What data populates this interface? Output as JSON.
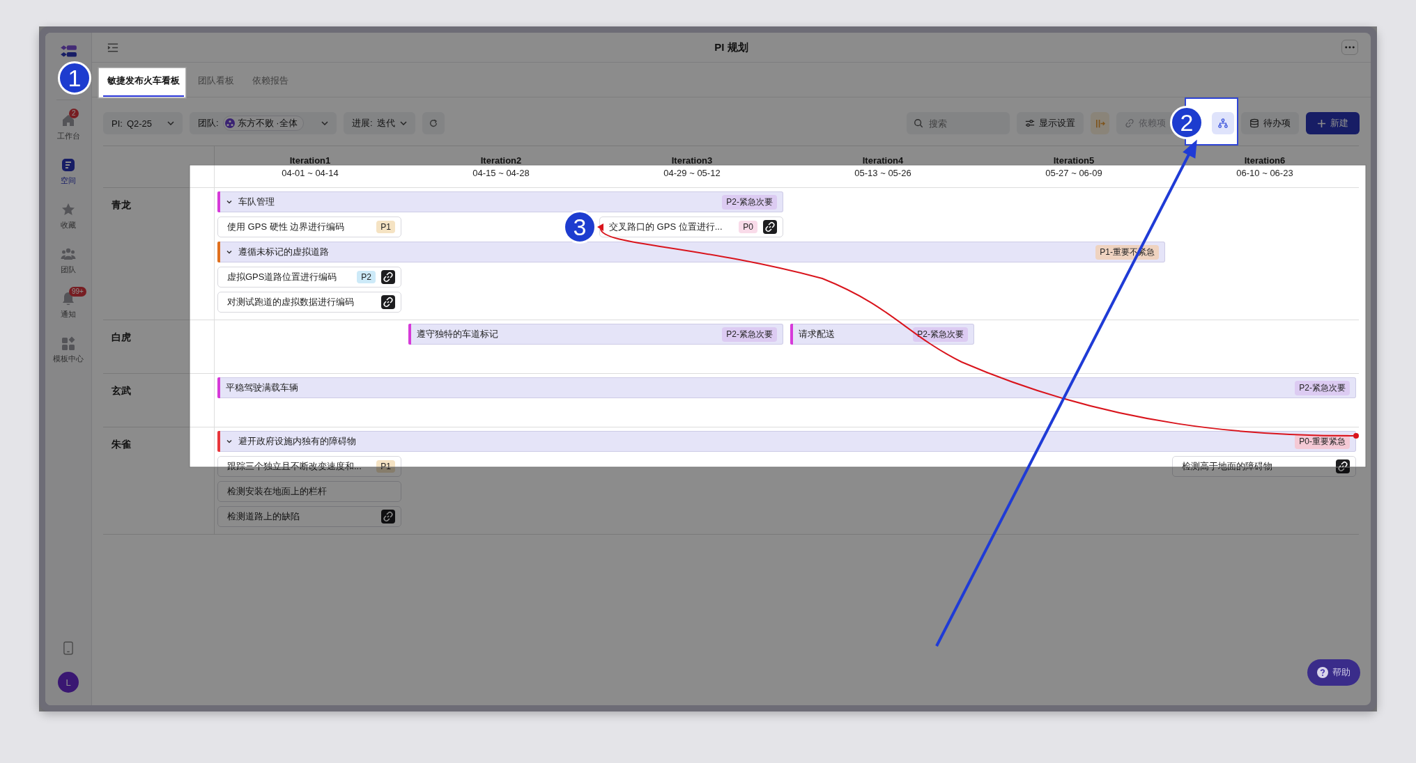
{
  "window": {
    "title": "PI 规划"
  },
  "sidebar": {
    "items": [
      {
        "kind": "home",
        "label": "工作台",
        "badge": "2",
        "selected": false
      },
      {
        "kind": "space",
        "label": "空间",
        "selected": true
      },
      {
        "kind": "star",
        "label": "收藏",
        "selected": false
      },
      {
        "kind": "team",
        "label": "团队",
        "selected": false
      },
      {
        "kind": "bell",
        "label": "通知",
        "badge": "99+",
        "selected": false
      },
      {
        "kind": "grid",
        "label": "模板中心",
        "selected": false
      }
    ],
    "avatar": "L"
  },
  "tabs": [
    {
      "label": "敏捷发布火车看板",
      "selected": true
    },
    {
      "label": "团队看板",
      "selected": false
    },
    {
      "label": "依赖报告",
      "selected": false
    }
  ],
  "filters": [
    {
      "kind": "plain",
      "label": "PI:",
      "value": "Q2-25"
    },
    {
      "kind": "chip",
      "label": "团队:",
      "value": "东方不败 ·全体"
    },
    {
      "kind": "plain",
      "label": "进展:",
      "value": "迭代"
    }
  ],
  "search": {
    "placeholder": "搜索"
  },
  "toolbar_buttons": [
    {
      "kind": "settings",
      "label": "显示设置"
    },
    {
      "kind": "split"
    },
    {
      "kind": "link",
      "label": "依赖项",
      "disabled": true
    },
    {
      "kind": "hierarchy",
      "on": true
    },
    {
      "kind": "backlog",
      "label": "待办项"
    },
    {
      "kind": "new",
      "label": "新建"
    }
  ],
  "iterations": [
    {
      "name": "Iteration1",
      "dates": "04-01 ~ 04-14"
    },
    {
      "name": "Iteration2",
      "dates": "04-15 ~ 04-28"
    },
    {
      "name": "Iteration3",
      "dates": "04-29 ~ 05-12"
    },
    {
      "name": "Iteration4",
      "dates": "05-13 ~ 05-26"
    },
    {
      "name": "Iteration5",
      "dates": "05-27 ~ 06-09"
    },
    {
      "name": "Iteration6",
      "dates": "06-10 ~ 06-23"
    }
  ],
  "teams": [
    {
      "name": "青龙",
      "lanes": [
        [
          {
            "kind": "feature",
            "title": "车队管理",
            "expanded": true,
            "color": "#d63ad9",
            "tag": {
              "text": "P2-紧急次要",
              "color": "#dccbf2"
            }
          },
          {
            "kind": "cont"
          },
          {
            "kind": "cont"
          },
          {
            "kind": "empty"
          },
          {
            "kind": "empty"
          },
          {
            "kind": "empty"
          }
        ],
        [
          {
            "kind": "story",
            "title": "使用 GPS 硬性 边界进行编码",
            "tag": {
              "text": "P1",
              "color": "#f5e3c3"
            },
            "linked": false
          },
          {
            "kind": "empty"
          },
          {
            "kind": "story",
            "title": "交叉路口的 GPS 位置进行...",
            "tag": {
              "text": "P0",
              "color": "#f9dbe9"
            },
            "linked": true
          },
          {
            "kind": "empty"
          },
          {
            "kind": "empty"
          },
          {
            "kind": "empty"
          }
        ],
        [
          {
            "kind": "feature",
            "title": "遵循未标记的虚拟道路",
            "expanded": true,
            "color": "#e0701e",
            "tag": {
              "text": "P1-重要不紧急",
              "color": "#efd3c0"
            }
          },
          {
            "kind": "cont"
          },
          {
            "kind": "cont"
          },
          {
            "kind": "cont"
          },
          {
            "kind": "cont"
          },
          {
            "kind": "empty"
          }
        ],
        [
          {
            "kind": "story",
            "title": "虚拟GPS道路位置进行编码",
            "tag": {
              "text": "P2",
              "color": "#cdeaf8"
            },
            "linked": true
          }
        ],
        [
          {
            "kind": "story",
            "title": "对测试跑道的虚拟数据进行编码",
            "linked": true
          }
        ]
      ]
    },
    {
      "name": "白虎",
      "lanes": [
        [
          {
            "kind": "empty"
          },
          {
            "kind": "feature",
            "title": "遵守独特的车道标记",
            "color": "#d63ad9",
            "tag": {
              "text": "P2-紧急次要",
              "color": "#dccbf2"
            }
          },
          {
            "kind": "cont"
          },
          {
            "kind": "feature",
            "title": "请求配送",
            "color": "#d63ad9",
            "tag": {
              "text": "P2-紧急次要",
              "color": "#dccbf2"
            }
          }
        ]
      ]
    },
    {
      "name": "玄武",
      "lanes": [
        [
          {
            "kind": "feature",
            "title": "平稳驾驶满载车辆",
            "color": "#d63ad9",
            "tag": {
              "text": "P2-紧急次要",
              "color": "#dccbf2"
            }
          },
          {
            "kind": "cont"
          },
          {
            "kind": "cont"
          },
          {
            "kind": "cont"
          },
          {
            "kind": "cont"
          },
          {
            "kind": "cont"
          }
        ]
      ]
    },
    {
      "name": "朱雀",
      "lanes": [
        [
          {
            "kind": "feature",
            "title": "避开政府设施内独有的障碍物",
            "expanded": true,
            "color": "#e8363b",
            "tag": {
              "text": "P0-重要紧急",
              "color": "#f4c9d5"
            }
          },
          {
            "kind": "cont"
          },
          {
            "kind": "cont"
          },
          {
            "kind": "cont"
          },
          {
            "kind": "cont"
          },
          {
            "kind": "cont"
          }
        ],
        [
          {
            "kind": "story",
            "title": "跟踪三个独立且不断改变速度和...",
            "tag": {
              "text": "P1",
              "color": "#f5e3c3"
            },
            "linked": false
          },
          {
            "kind": "empty"
          },
          {
            "kind": "empty"
          },
          {
            "kind": "empty"
          },
          {
            "kind": "empty"
          },
          {
            "kind": "story",
            "title": "检测高于地面的障碍物",
            "linked": true
          }
        ],
        [
          {
            "kind": "story",
            "title": "检测安装在地面上的栏杆",
            "linked": false
          }
        ],
        [
          {
            "kind": "story",
            "title": "检测道路上的缺陷",
            "linked": true
          }
        ]
      ]
    }
  ],
  "callouts": [
    "1",
    "2",
    "3"
  ],
  "help_button": "帮助"
}
